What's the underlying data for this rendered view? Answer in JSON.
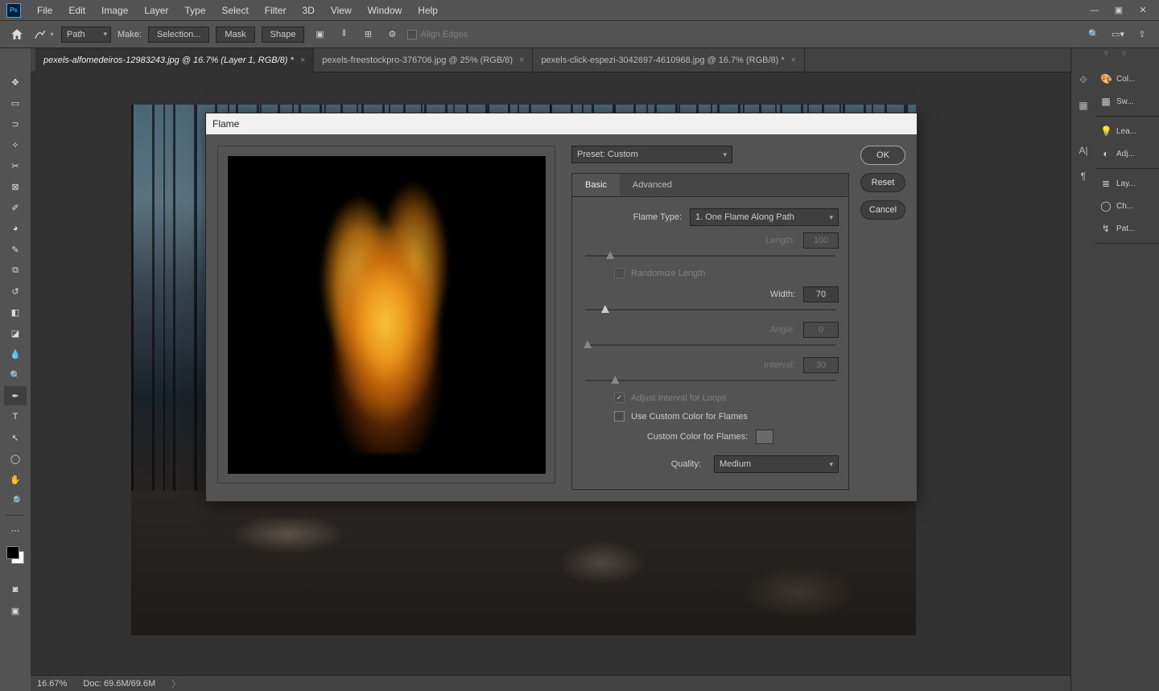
{
  "menu": {
    "items": [
      "File",
      "Edit",
      "Image",
      "Layer",
      "Type",
      "Select",
      "Filter",
      "3D",
      "View",
      "Window",
      "Help"
    ]
  },
  "options": {
    "dropdown": "Path",
    "make_label": "Make:",
    "selection": "Selection...",
    "mask": "Mask",
    "shape": "Shape",
    "align_edges": "Align Edges"
  },
  "doc_tabs": [
    {
      "title": "pexels-alfomedeiros-12983243.jpg @ 16.7% (Layer 1, RGB/8) *",
      "active": true
    },
    {
      "title": "pexels-freestockpro-376706.jpg @ 25% (RGB/8)",
      "active": false
    },
    {
      "title": "pexels-click-espezi-3042697-4610968.jpg @ 16.7% (RGB/8) *",
      "active": false
    }
  ],
  "dialog": {
    "title": "Flame",
    "preset_label": "Preset:",
    "preset_value": "Custom",
    "tabs": {
      "basic": "Basic",
      "advanced": "Advanced"
    },
    "flame_type_label": "Flame Type:",
    "flame_type_value": "1. One Flame Along Path",
    "length_label": "Length:",
    "length_value": "100",
    "randomize_label": "Randomize Length",
    "width_label": "Width:",
    "width_value": "70",
    "angle_label": "Angle:",
    "angle_value": "0",
    "interval_label": "Interval:",
    "interval_value": "30",
    "adjust_interval_label": "Adjust Interval for Loops",
    "use_custom_color_label": "Use Custom Color for Flames",
    "custom_color_label": "Custom Color for Flames:",
    "quality_label": "Quality:",
    "quality_value": "Medium",
    "ok": "OK",
    "reset": "Reset",
    "cancel": "Cancel"
  },
  "right_panels": {
    "group1": [
      {
        "icon": "🎨",
        "label": "Col..."
      },
      {
        "icon": "▦",
        "label": "Sw..."
      }
    ],
    "group2": [
      {
        "icon": "💡",
        "label": "Lea..."
      },
      {
        "icon": "◐",
        "label": "Adj..."
      }
    ],
    "group3": [
      {
        "icon": "≣",
        "label": "Lay..."
      },
      {
        "icon": "◯",
        "label": "Ch..."
      },
      {
        "icon": "↯",
        "label": "Pat..."
      }
    ]
  },
  "status": {
    "zoom": "16.67%",
    "doc": "Doc: 69.6M/69.6M"
  }
}
